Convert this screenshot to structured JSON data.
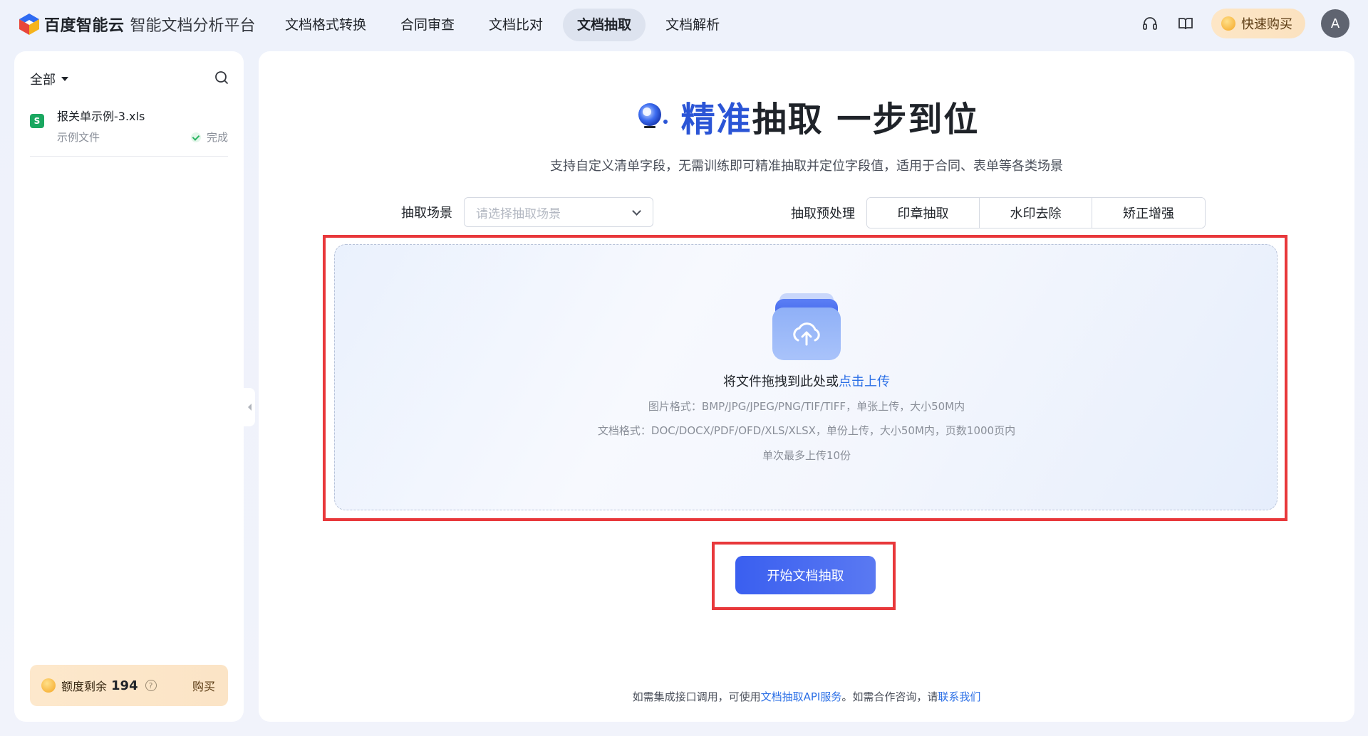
{
  "header": {
    "brand": "百度智能云",
    "product": "智能文档分析平台",
    "nav": [
      {
        "label": "文档格式转换",
        "active": false
      },
      {
        "label": "合同审查",
        "active": false
      },
      {
        "label": "文档比对",
        "active": false
      },
      {
        "label": "文档抽取",
        "active": true
      },
      {
        "label": "文档解析",
        "active": false
      }
    ],
    "icons": [
      "headset-icon",
      "book-icon"
    ],
    "buy_label": "快速购买",
    "avatar_letter": "A"
  },
  "sidebar": {
    "filter_label": "全部",
    "files": [
      {
        "icon_letter": "S",
        "name": "报关单示例-3.xls",
        "type": "示例文件",
        "status": "完成"
      }
    ],
    "quota": {
      "label": "额度剩余",
      "value": "194",
      "help": "?",
      "buy": "购买"
    }
  },
  "main": {
    "hero": {
      "accent": "精准",
      "rest": "抽取 一步到位"
    },
    "subtitle": "支持自定义清单字段，无需训练即可精准抽取并定位字段值，适用于合同、表单等各类场景",
    "scene_label": "抽取场景",
    "scene_placeholder": "请选择抽取场景",
    "preprocess_label": "抽取预处理",
    "preprocess_options": [
      "印章抽取",
      "水印去除",
      "矫正增强"
    ],
    "upload": {
      "text": "将文件拖拽到此处或",
      "link": "点击上传",
      "hint_image": "图片格式：BMP/JPG/JPEG/PNG/TIF/TIFF，单张上传，大小50M内",
      "hint_doc": "文档格式：DOC/DOCX/PDF/OFD/XLS/XLSX，单份上传，大小50M内，页数1000页内",
      "hint_limit": "单次最多上传10份"
    },
    "start_button": "开始文档抽取",
    "footer": {
      "prefix": "如需集成接口调用，可使用",
      "api_link": "文档抽取API服务",
      "middle": "。如需合作咨询，请",
      "contact_link": "联系我们"
    }
  },
  "colors": {
    "accent": "#2b55d6",
    "link": "#2b6fe6",
    "highlight": "#e8383b",
    "success": "#2bb563"
  }
}
